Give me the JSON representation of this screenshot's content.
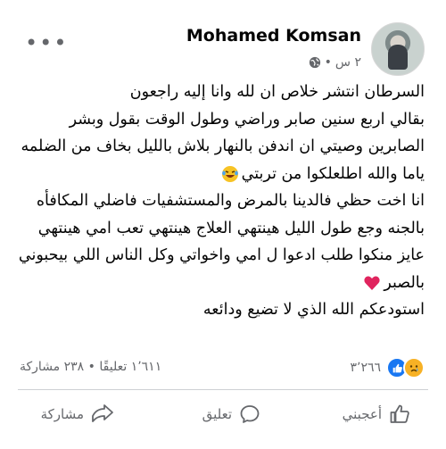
{
  "post": {
    "author": "Mohamed Komsan",
    "time": "٢ س",
    "dot": "•",
    "paragraphs": [
      "السرطان انتشر خلاص ان لله وانا إليه راجعون",
      "بقالي اربع سنين صابر وراضي وطول الوقت بقول وبشر الصابرين وصيتي ان اندفن بالنهار بلاش بالليل بخاف من الضلمه ياما والله اطلعلكوا من تربتي",
      "انا اخت حظي فالدينا بالمرض والمستشفيات فاضلي المكافأه بالجنه وجع طول الليل هينتهي العلاج  هينتهي تعب امي هينتهي عايز منكوا طلب ادعوا ل امي واخواتي وكل الناس اللي بيحبوني بالصبر",
      "استودعكم الله الذي لا تضيع ودائعه"
    ]
  },
  "stats": {
    "reactions_count": "٣٬٢٦٦",
    "comments": "١٬٦١١ تعليقًا",
    "separator": "•",
    "shares": "٢٣٨ مشاركة"
  },
  "actions": {
    "like": "أعجبني",
    "comment": "تعليق",
    "share": "مشاركة"
  },
  "icons": {
    "privacy": "globe-icon",
    "more": "more-options-icon",
    "laugh": "laughing-emoji",
    "heart": "red-heart-emoji",
    "like_reaction": "like-reaction-icon",
    "sad_reaction": "sad-reaction-icon"
  },
  "colors": {
    "secondary_text": "#65676b",
    "like_blue": "#1877f2",
    "sad_yellow": "#f7b125",
    "heart_red": "#e0245e"
  }
}
